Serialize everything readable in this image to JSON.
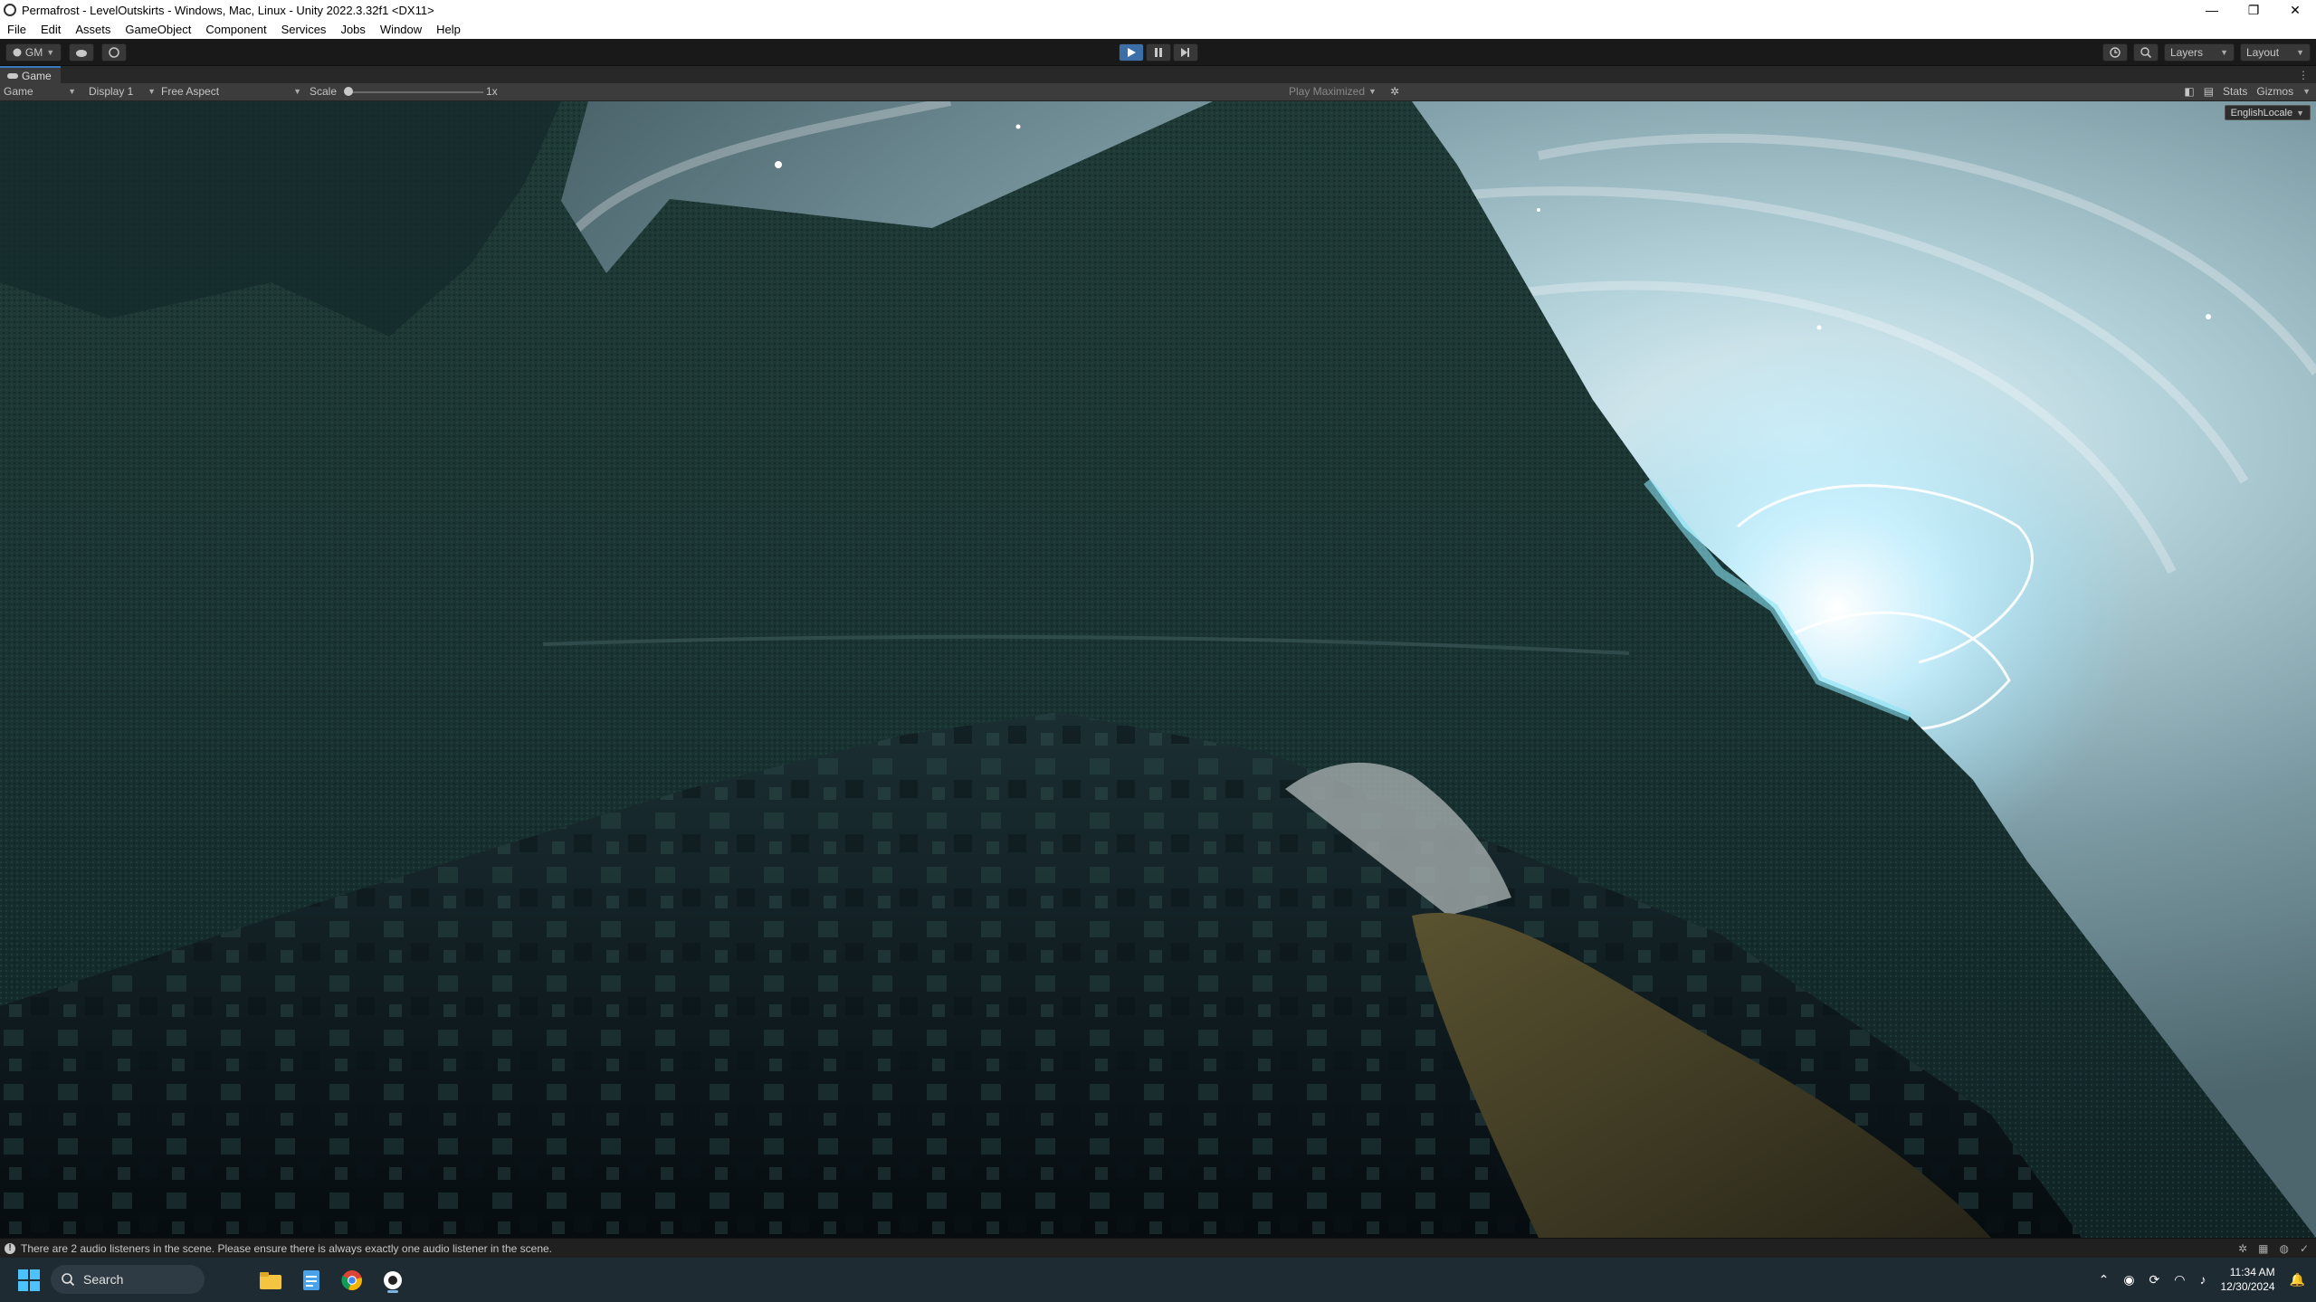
{
  "window": {
    "title": "Permafrost - LevelOutskirts - Windows, Mac, Linux - Unity 2022.3.32f1 <DX11>",
    "minimize": "—",
    "maximize": "❐",
    "close": "✕"
  },
  "menu": [
    "File",
    "Edit",
    "Assets",
    "GameObject",
    "Component",
    "Services",
    "Jobs",
    "Window",
    "Help"
  ],
  "toolbar": {
    "account_label": "GM",
    "layers_label": "Layers",
    "layout_label": "Layout"
  },
  "game_tab": {
    "label": "Game"
  },
  "game_toolbar": {
    "view_mode": "Game",
    "display": "Display 1",
    "aspect": "Free Aspect",
    "scale_label": "Scale",
    "scale_value": "1x",
    "play_mode": "Play Maximized",
    "stats_label": "Stats",
    "gizmos_label": "Gizmos"
  },
  "viewport": {
    "locale_label": "EnglishLocale"
  },
  "status": {
    "message": "There are 2 audio listeners in the scene. Please ensure there is always exactly one audio listener in the scene."
  },
  "taskbar": {
    "search_placeholder": "Search",
    "time": "11:34 AM",
    "date": "12/30/2024",
    "apps": [
      "file-explorer",
      "notepad",
      "chrome",
      "unity"
    ]
  },
  "colors": {
    "accent": "#3a79bb",
    "play_active": "#3c6fa8",
    "taskbar": "#1f2b33"
  }
}
